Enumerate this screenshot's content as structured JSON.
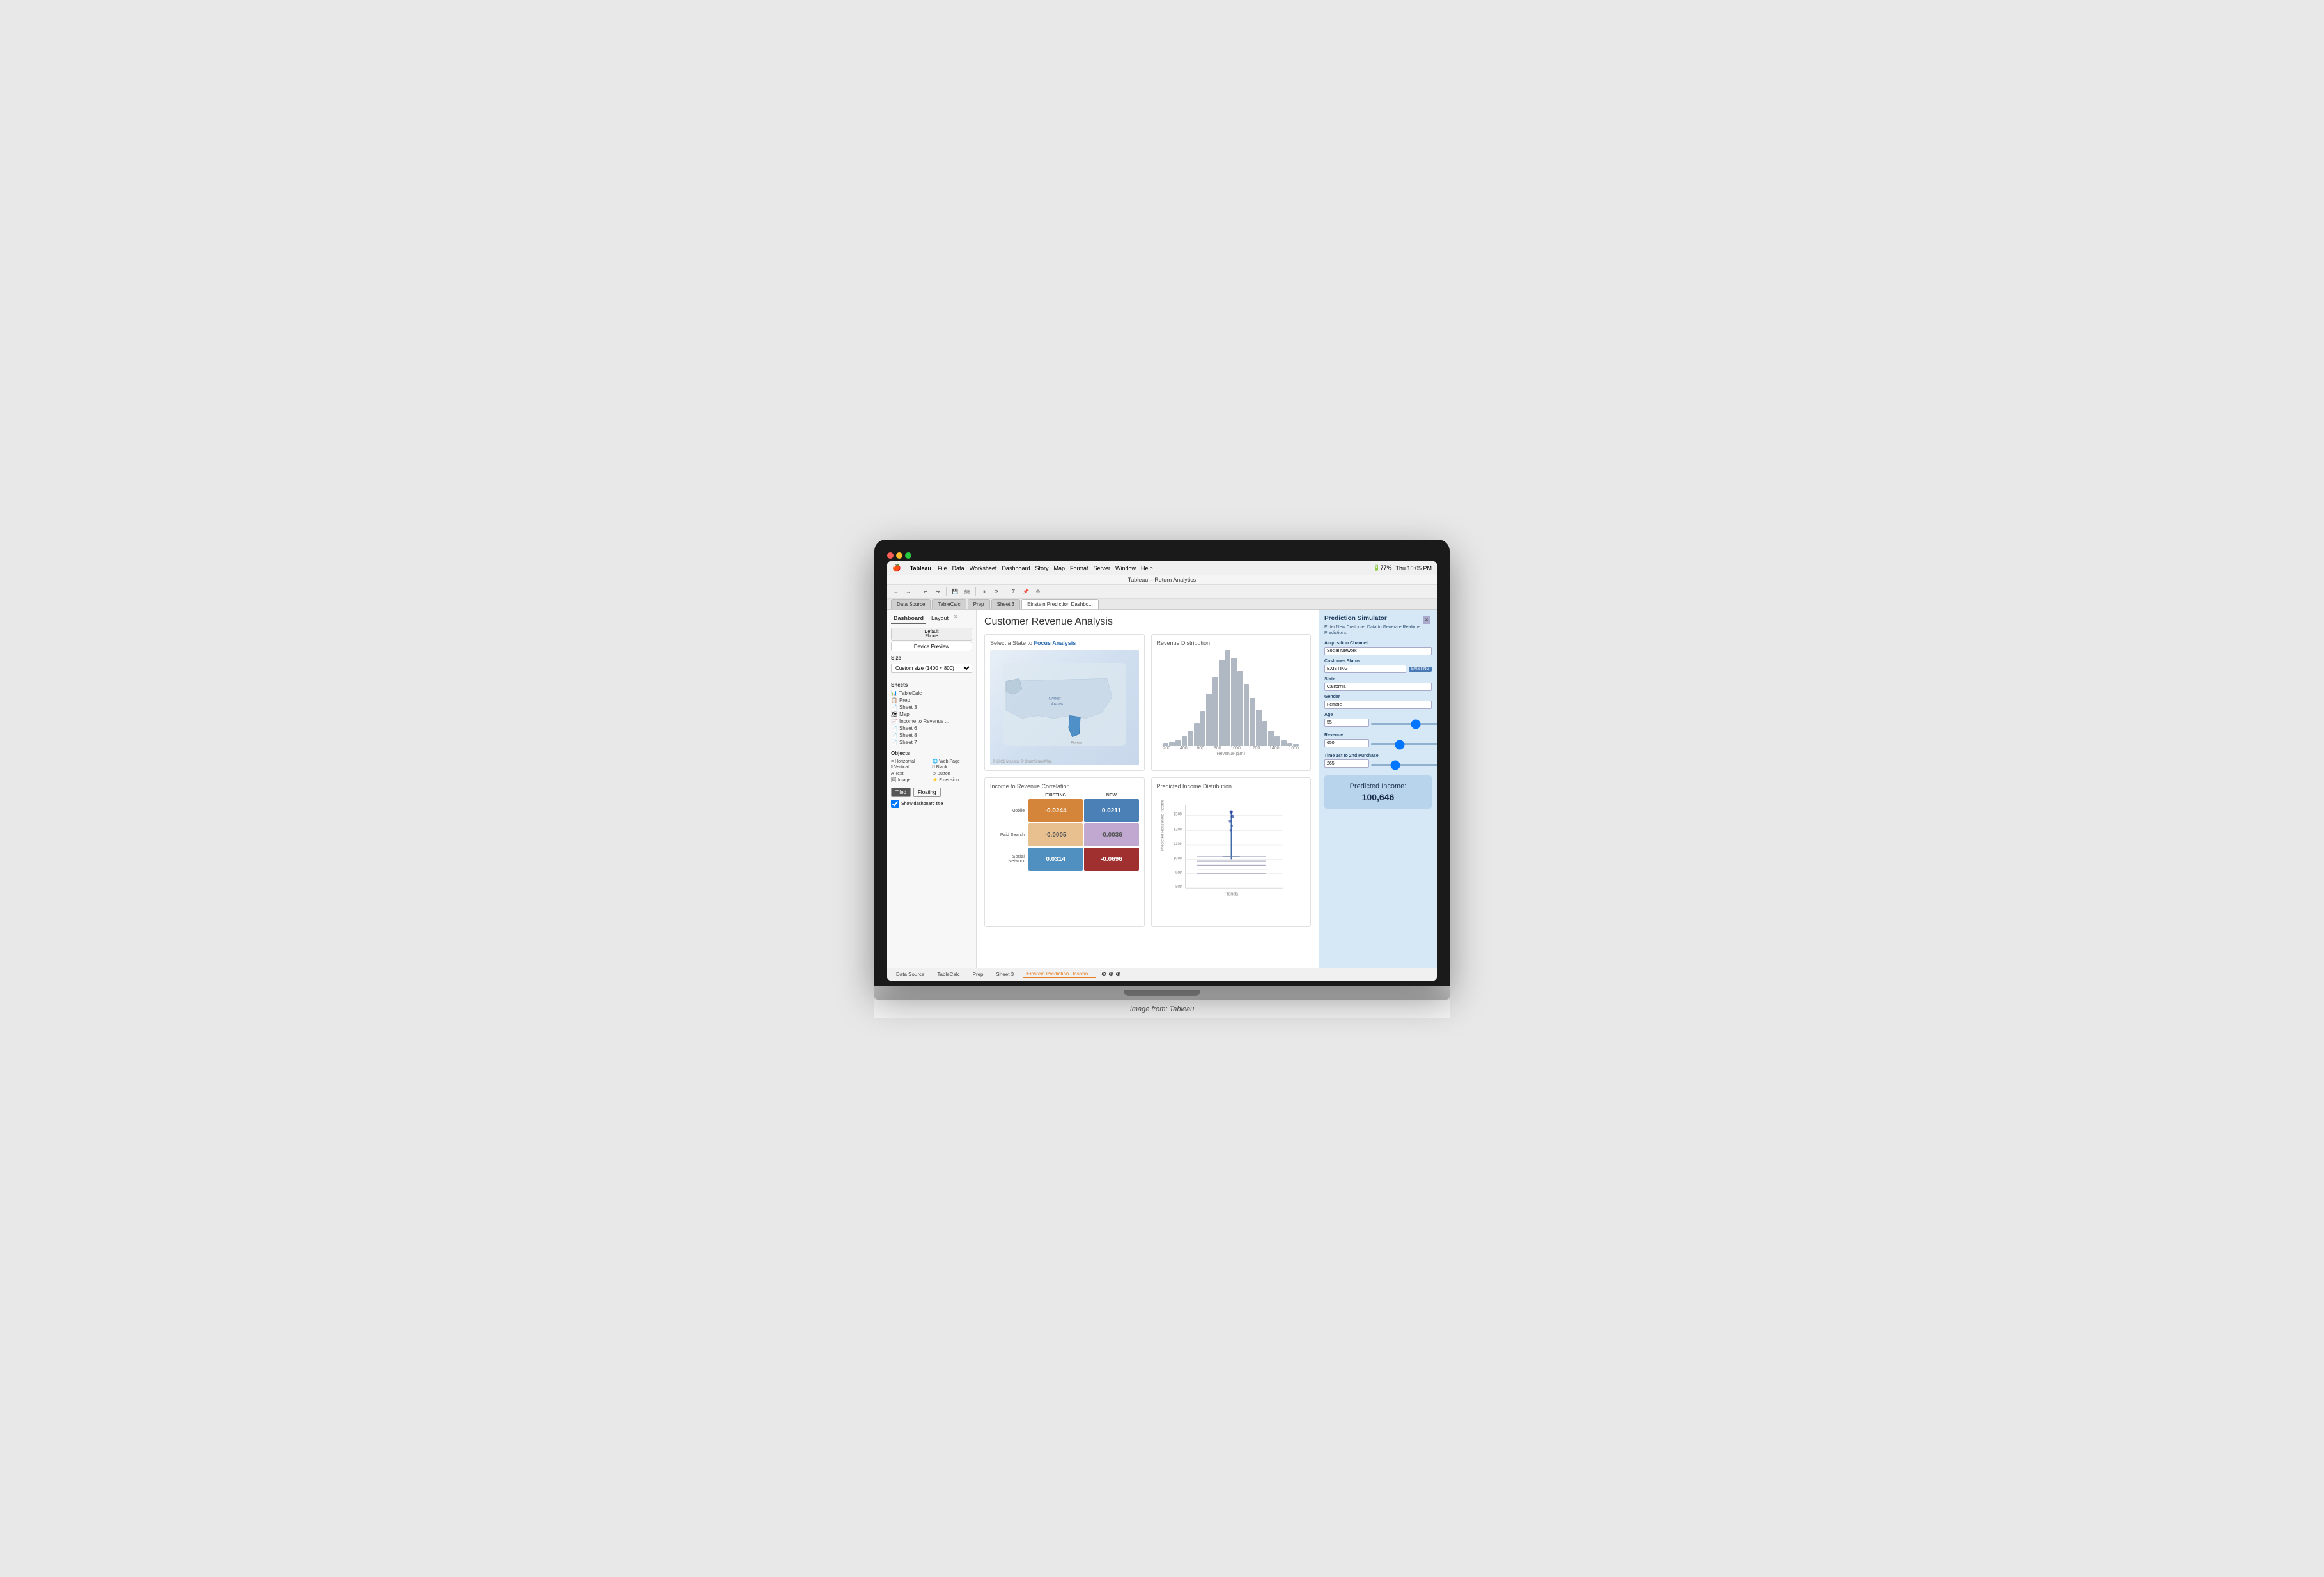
{
  "window": {
    "title": "Tableau – Return Analytics",
    "caption": "Image from: Tableau"
  },
  "menubar": {
    "app": "Tableau",
    "items": [
      "File",
      "Data",
      "Worksheet",
      "Dashboard",
      "Story",
      "Map",
      "Format",
      "Server",
      "Window",
      "Help"
    ],
    "right": "Thu 10:05 PM"
  },
  "toolbar": {
    "items": [
      "←",
      "→",
      "↑",
      "↓",
      "⊕",
      "⊖",
      "⟳",
      "▶",
      "⏪",
      "⏩",
      "📋",
      "🔍",
      "Σ",
      "⚙"
    ]
  },
  "tabs": {
    "items": [
      "Data Source",
      "TableCalc",
      "Prep",
      "Sheet 3",
      "Einstein Prediction Dashbo..."
    ],
    "active": 4
  },
  "sidebar": {
    "tabs": [
      "Dashboard",
      "Layout"
    ],
    "active_tab": "Dashboard",
    "default_label": "Default",
    "phone_label": "Phone",
    "device_preview_btn": "Device Preview",
    "size_label": "Size",
    "size_value": "Custom size (1400 × 800)",
    "sheets_title": "Sheets",
    "sheets": [
      {
        "icon": "📊",
        "label": "TableCalc"
      },
      {
        "icon": "📋",
        "label": "Prep"
      },
      {
        "icon": "📄",
        "label": "Sheet 3"
      },
      {
        "icon": "🗺",
        "label": "Map"
      },
      {
        "icon": "📈",
        "label": "Income to Revenue ..."
      },
      {
        "icon": "📄",
        "label": "Sheet 6"
      },
      {
        "icon": "📄",
        "label": "Sheet 8"
      },
      {
        "icon": "📄",
        "label": "Sheet 7"
      }
    ],
    "objects_title": "Objects",
    "objects": [
      {
        "icon": "≡",
        "label": "Horizontal"
      },
      {
        "icon": "🌐",
        "label": "Web Page"
      },
      {
        "icon": "‖",
        "label": "Vertical"
      },
      {
        "icon": "□",
        "label": "Blank"
      },
      {
        "icon": "A",
        "label": "Text"
      },
      {
        "icon": "⊙",
        "label": "Button"
      },
      {
        "icon": "🖼",
        "label": "Image"
      },
      {
        "icon": "⚡",
        "label": "Extension"
      }
    ],
    "tiled_btn": "Tiled",
    "floating_btn": "Floating",
    "show_dashboard_title": "Show dashboard title"
  },
  "dashboard": {
    "title": "Customer Revenue Analysis",
    "map_section": {
      "title": "Select a State to ",
      "title_highlight": "Focus Analysis"
    },
    "revenue_section": {
      "title": "Revenue Distribution",
      "x_axis_label": "Revenue ($m)",
      "x_ticks": [
        "200",
        "400",
        "600",
        "800",
        "1000",
        "1200",
        "1400",
        "1600"
      ],
      "bars": [
        2,
        3,
        5,
        8,
        12,
        18,
        28,
        42,
        58,
        72,
        85,
        95,
        88,
        70,
        55,
        40,
        28,
        18,
        10,
        6,
        3,
        2
      ]
    },
    "correlation_section": {
      "title": "Income to Revenue Correlation",
      "col_labels": [
        "EXISTING",
        "NEW"
      ],
      "rows": [
        {
          "label": "Mobile",
          "values": [
            "-0.0244",
            "0.0211"
          ],
          "colors": [
            "#d4853a",
            "#4a80b5"
          ]
        },
        {
          "label": "Paid Search",
          "values": [
            "-0.0005",
            "-0.0036"
          ],
          "colors": [
            "#e8c090",
            "#c0a8d0"
          ]
        },
        {
          "label": "Social\nNetwork",
          "values": [
            "0.0314",
            "-0.0696"
          ],
          "colors": [
            "#5090c0",
            "#a03030"
          ]
        }
      ]
    },
    "predicted_section": {
      "title": "Predicted Income Distribution",
      "y_label": "Predicted Household Income",
      "y_ticks": [
        "80K",
        "90K",
        "100K",
        "110K",
        "120K",
        "130K"
      ],
      "state_label": "Florida"
    }
  },
  "prediction_simulator": {
    "title": "Prediction Simulator",
    "subtitle": "Enter New Customer Data to Generate Realtime Predictions",
    "acquisition_channel_label": "Acquisition Channel",
    "acquisition_channel_value": "Social Network",
    "customer_status_label": "Customer Status",
    "customer_status_value": "EXISTING",
    "customer_status_badge": "EXISTING",
    "state_label": "State",
    "state_value": "California",
    "gender_label": "Gender",
    "gender_value": "Female",
    "age_label": "Age",
    "age_value": "55",
    "revenue_label": "Revenue",
    "revenue_value": "650",
    "time_label": "Time 1st to 2nd Purchase",
    "time_value": "265",
    "predicted_income_label": "Predicted Income:",
    "predicted_income_value": "100,646"
  }
}
